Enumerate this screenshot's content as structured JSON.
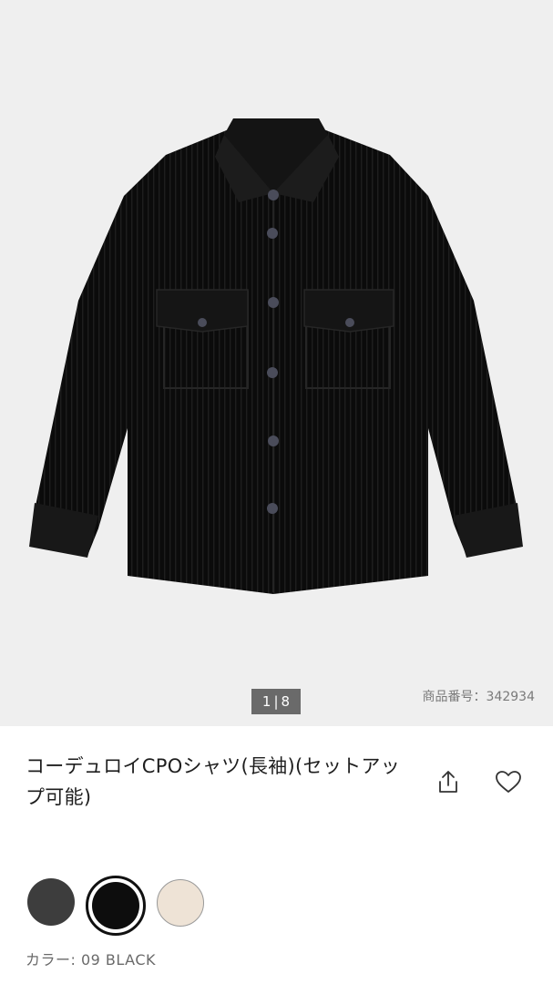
{
  "gallery": {
    "current": "1",
    "total": "8",
    "separator": "|",
    "image_subject": "black corduroy shirt"
  },
  "product": {
    "number_label": "商品番号：342934",
    "title": "コーデュロイCPOシャツ(長袖)(セットアップ可能)"
  },
  "actions": {
    "share_icon": "share-icon",
    "favorite_icon": "heart-icon"
  },
  "colors": {
    "swatches": [
      {
        "hex": "#3d3d3d",
        "selected": false
      },
      {
        "hex": "#0d0d0d",
        "selected": true
      },
      {
        "hex": "#eee3d6",
        "selected": false
      }
    ],
    "selected_label": "カラー: 09 BLACK"
  }
}
